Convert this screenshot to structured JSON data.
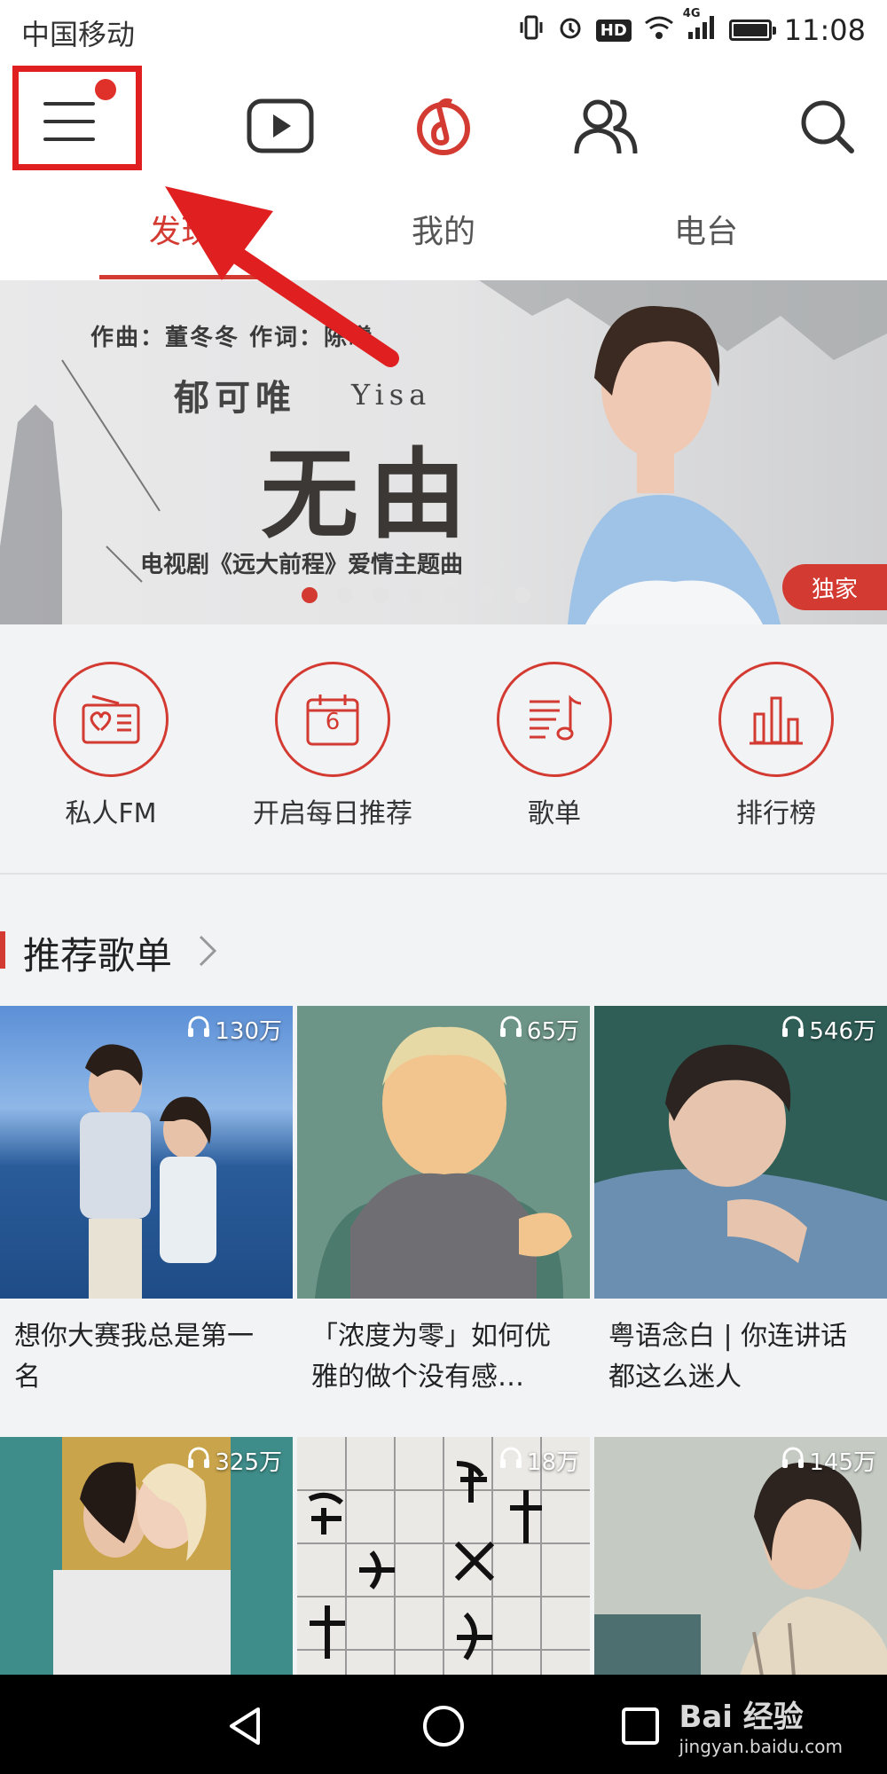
{
  "status_bar": {
    "carrier": "中国移动",
    "network": "4G",
    "time": "11:08",
    "icons": [
      "vibrate-icon",
      "alarm-icon",
      "hd-icon",
      "wifi-icon",
      "signal-icon",
      "battery-icon"
    ],
    "hd_label": "HD"
  },
  "top_bar": {
    "icons": [
      "menu-icon",
      "video-icon",
      "netease-music-logo",
      "friends-icon",
      "search-icon"
    ],
    "menu_notification": true
  },
  "tabs": [
    {
      "label": "发现",
      "active": true
    },
    {
      "label": "我的",
      "active": false
    },
    {
      "label": "电台",
      "active": false
    }
  ],
  "banner": {
    "credits": "作曲：董冬冬  作词：陈曦",
    "artist_cn": "郁可唯",
    "artist_en": "Yisa",
    "title": "无由",
    "subtitle": "电视剧《远大前程》爱情主题曲",
    "badge": "独家",
    "slide_count": 7,
    "active_slide": 1
  },
  "quick_entries": [
    {
      "label": "私人FM",
      "icon": "radio-icon"
    },
    {
      "label": "开启每日推荐",
      "icon": "calendar-icon",
      "icon_text": "6"
    },
    {
      "label": "歌单",
      "icon": "playlist-icon"
    },
    {
      "label": "排行榜",
      "icon": "chart-icon"
    }
  ],
  "section": {
    "title": "推荐歌单"
  },
  "playlists": [
    {
      "title": "想你大赛我总是第一名",
      "plays": "130万"
    },
    {
      "title": "「浓度为零」如何优雅的做个没有感…",
      "plays": "65万"
    },
    {
      "title": "粤语念白 | 你连讲话都这么迷人",
      "plays": "546万"
    },
    {
      "title": "",
      "plays": "325万"
    },
    {
      "title": "",
      "plays": "18万"
    },
    {
      "title": "",
      "plays": "145万"
    }
  ],
  "watermark": {
    "main": "Bai 经验",
    "sub": "jingyan.baidu.com"
  },
  "colors": {
    "accent": "#d33a31",
    "highlight_box": "#e02020"
  }
}
